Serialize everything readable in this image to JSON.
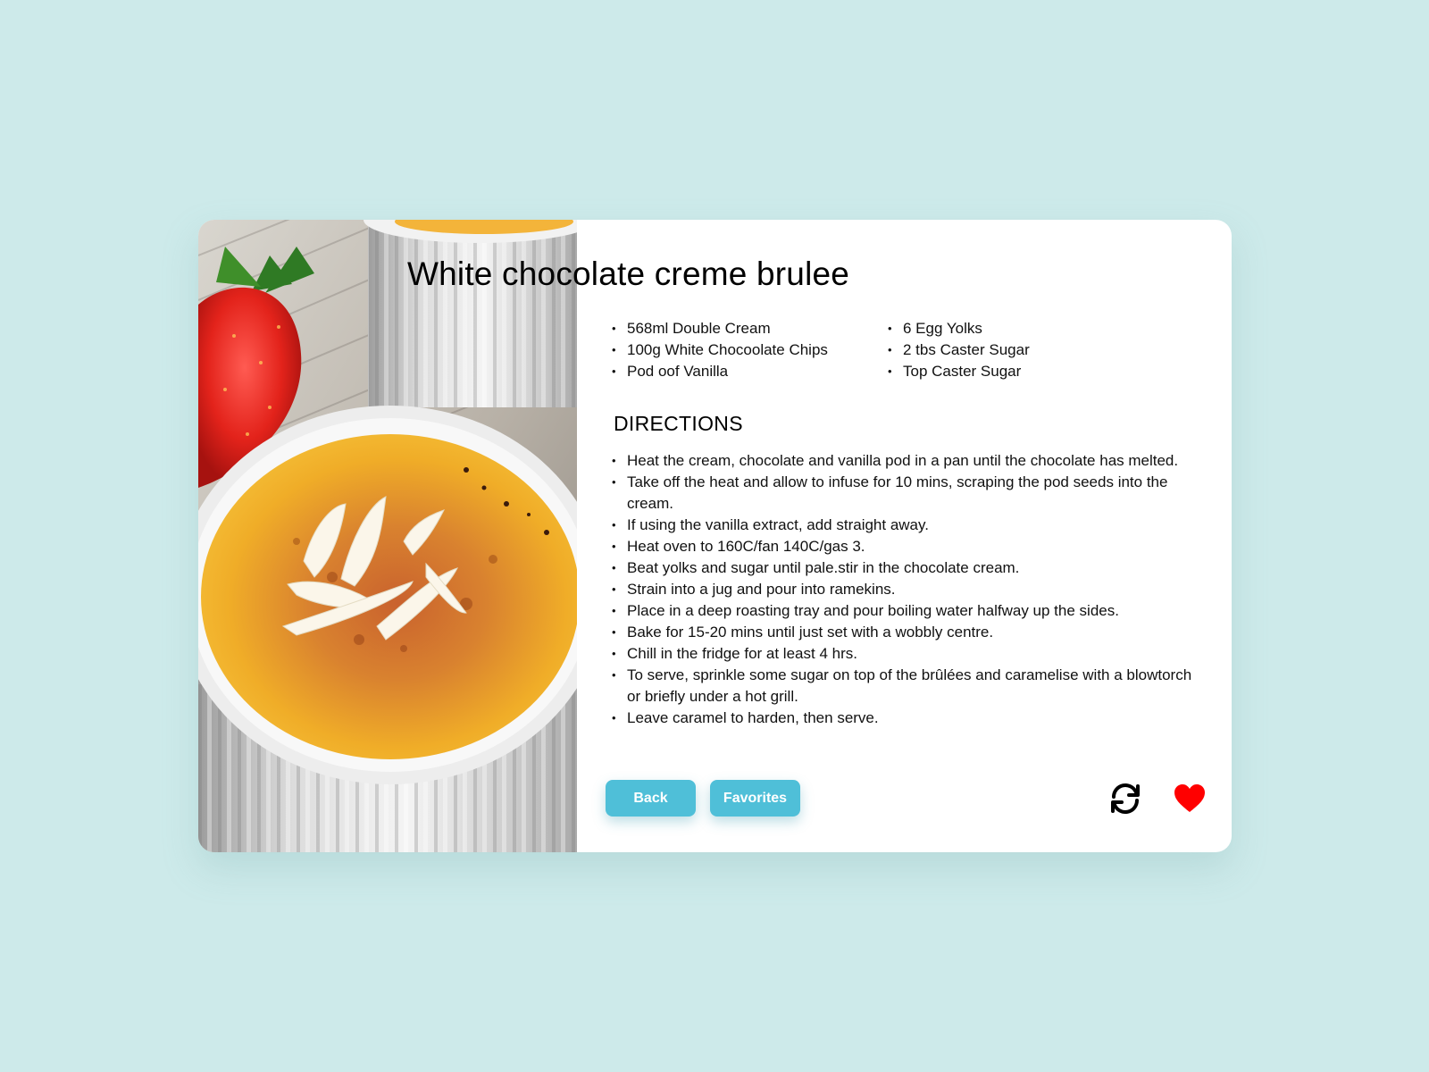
{
  "recipe": {
    "title": "White chocolate creme brulee",
    "ingredients_left": [
      "568ml Double Cream",
      "100g White Chocoolate Chips",
      "Pod oof Vanilla"
    ],
    "ingredients_right": [
      "6 Egg Yolks",
      "2 tbs Caster Sugar",
      "Top Caster Sugar"
    ],
    "directions_heading": "DIRECTIONS",
    "directions": [
      "Heat the cream, chocolate and vanilla pod in a pan until the chocolate has melted.",
      "Take off the heat and allow to infuse for 10 mins, scraping the pod seeds into the cream.",
      "If using the vanilla extract, add straight away.",
      "Heat oven to 160C/fan 140C/gas 3.",
      "Beat yolks and sugar until pale.stir in the chocolate cream.",
      "Strain into a jug and pour into ramekins.",
      "Place in a deep roasting tray and pour boiling water halfway up the sides.",
      "Bake for 15-20 mins until just set with a wobbly centre.",
      "Chill in the fridge for at least 4 hrs.",
      "To serve, sprinkle some sugar on top of the brûlées and caramelise with a blowtorch or briefly under a hot grill.",
      "Leave caramel to harden, then serve."
    ]
  },
  "actions": {
    "back_label": "Back",
    "favorites_label": "Favorites",
    "refresh_icon": "refresh-icon",
    "heart_icon": "heart-icon"
  },
  "colors": {
    "background": "#cdeaea",
    "card": "#ffffff",
    "button": "#4fbfd8",
    "heart": "#ff0000"
  }
}
